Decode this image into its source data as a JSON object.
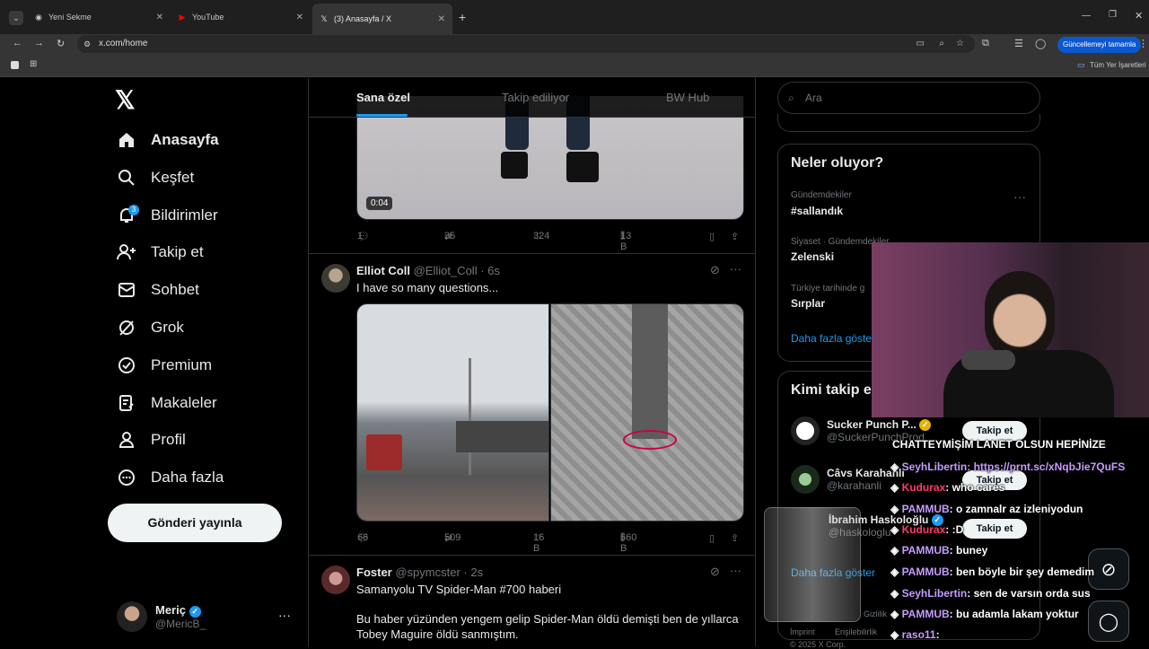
{
  "browser": {
    "tabs": [
      {
        "title": "Yeni Sekme"
      },
      {
        "title": "YouTube"
      },
      {
        "title": "(3) Anasayfa / X"
      }
    ],
    "url": "x.com/home",
    "update_label": "Güncellemeyi tamamla",
    "bookmarks_label": "Tüm Yer İşaretleri"
  },
  "sidebar": {
    "items": [
      {
        "label": "Anasayfa",
        "icon": "home-icon"
      },
      {
        "label": "Keşfet",
        "icon": "search-icon"
      },
      {
        "label": "Bildirimler",
        "icon": "bell-icon",
        "badge": "3"
      },
      {
        "label": "Takip et",
        "icon": "follow-icon"
      },
      {
        "label": "Sohbet",
        "icon": "mail-icon"
      },
      {
        "label": "Grok",
        "icon": "grok-icon"
      },
      {
        "label": "Premium",
        "icon": "premium-icon"
      },
      {
        "label": "Makaleler",
        "icon": "articles-icon"
      },
      {
        "label": "Profil",
        "icon": "profile-icon"
      },
      {
        "label": "Daha fazla",
        "icon": "more-icon"
      }
    ],
    "post_button": "Gönderi yayınla",
    "account": {
      "name": "Meriç",
      "handle": "@MericB_"
    }
  },
  "feed": {
    "tabs": [
      "Sana özel",
      "Takip ediliyor",
      "BW Hub"
    ],
    "tweet1": {
      "video_time": "0:04",
      "replies": "1",
      "retweets": "35",
      "likes": "324",
      "views": "13 B"
    },
    "tweet2": {
      "name": "Elliot Coll",
      "handle": "@Elliot_Coll",
      "time": "· 6s",
      "text": "I have so many questions...",
      "replies": "66",
      "retweets": "509",
      "likes": "16 B",
      "views": "660 B"
    },
    "tweet3": {
      "name": "Foster",
      "handle": "@spymcster",
      "time": "· 2s",
      "line1": "Samanyolu TV Spider-Man #700 haberi",
      "line2": "Bu haber yüzünden yengem gelip Spider-Man öldü demişti ben de yıllarca",
      "line3": "Tobey Maguire öldü sanmıştım."
    }
  },
  "right": {
    "search_placeholder": "Ara",
    "trends_title": "Neler oluyor?",
    "trends": [
      {
        "meta": "Gündemdekiler",
        "name": "#sallandık"
      },
      {
        "meta": "Siyaset · Gündemdekiler",
        "name": "Zelenski"
      },
      {
        "meta": "Türkiye tarihinde g",
        "name": "Sırplar"
      }
    ],
    "show_more": "Daha fazla göster",
    "who_title": "Kimi takip e",
    "who": [
      {
        "name": "Sucker Punch P...",
        "handle": "@SuckerPunchProd"
      },
      {
        "name": "Câvs Karahanlı",
        "handle": "@karahanli"
      },
      {
        "name": "İbrahim Haskoloğlu",
        "handle": "@haskologlu"
      }
    ],
    "follow_label": "Takip et",
    "who_more": "Daha fazla göster",
    "footer": [
      "Gizlilik",
      "İmprint",
      "Erişilebilirlik",
      "© 2025 X Corp."
    ]
  },
  "overlay": {
    "chat_title": "CHATTEYMİŞİM LANET OLSUN HEPİNİZE",
    "messages": [
      {
        "user": "SeyhLibertin",
        "text": ": https://prnt.sc/xNqbJie7QuFS"
      },
      {
        "user": "Kudurax",
        "text": ": who cares"
      },
      {
        "user": "PAMMUB",
        "text": ": o zamnalr az izleniyodun"
      },
      {
        "user": "Kudurax",
        "text": ": :D"
      },
      {
        "user": "PAMMUB",
        "text": ": buney"
      },
      {
        "user": "PAMMUB",
        "text": ": ben böyle bir şey demedim"
      },
      {
        "user": "SeyhLibertin",
        "text": ": sen de varsın orda sus"
      },
      {
        "user": "PAMMUB",
        "text": ": bu adamla lakam yoktur"
      },
      {
        "user": "raso11",
        "text": ":"
      }
    ]
  }
}
